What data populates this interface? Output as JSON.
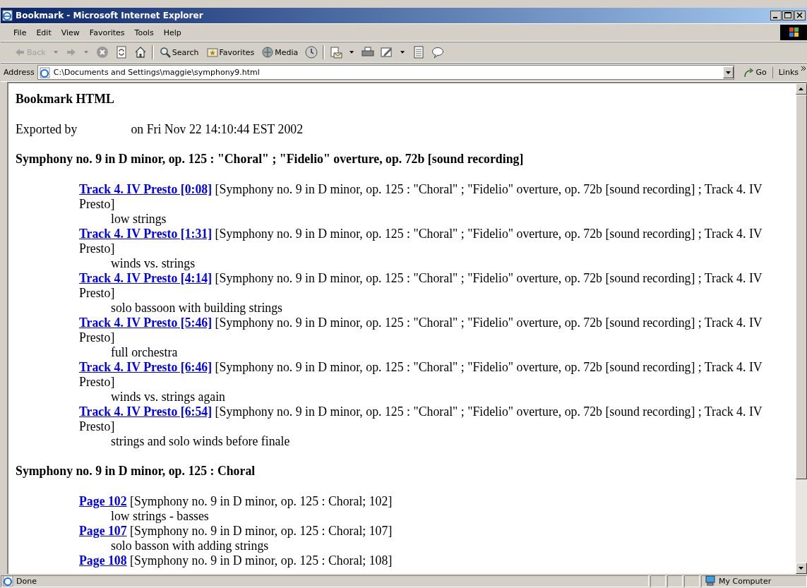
{
  "window": {
    "title": "Bookmark - Microsoft Internet Explorer"
  },
  "menu": [
    "File",
    "Edit",
    "View",
    "Favorites",
    "Tools",
    "Help"
  ],
  "toolbar": {
    "back": {
      "label": "Back",
      "disabled": true
    },
    "search": "Search",
    "favorites": "Favorites",
    "media": "Media"
  },
  "address": {
    "label": "Address",
    "value": "C:\\Documents and Settings\\maggie\\symphony9.html",
    "go": "Go",
    "links": "Links"
  },
  "document": {
    "heading": "Bookmark HTML",
    "exported_by": "Exported by",
    "exported_on": "on Fri Nov 22 14:10:44 EST 2002",
    "sections": [
      {
        "title": "Symphony no. 9 in D minor, op. 125 : \"Choral\" ; \"Fidelio\" overture, op. 72b [sound recording]",
        "entries": [
          {
            "link": "Track 4. IV Presto [0:08]",
            "source": "[Symphony no. 9 in D minor, op. 125 : \"Choral\" ; \"Fidelio\" overture, op. 72b [sound recording] ; Track 4. IV Presto]",
            "note": "low strings"
          },
          {
            "link": "Track 4. IV Presto [1:31]",
            "source": "[Symphony no. 9 in D minor, op. 125 : \"Choral\" ; \"Fidelio\" overture, op. 72b [sound recording] ; Track 4. IV Presto]",
            "note": "winds vs. strings"
          },
          {
            "link": "Track 4. IV Presto [4:14]",
            "source": "[Symphony no. 9 in D minor, op. 125 : \"Choral\" ; \"Fidelio\" overture, op. 72b [sound recording] ; Track 4. IV Presto]",
            "note": "solo bassoon with building strings"
          },
          {
            "link": "Track 4. IV Presto [5:46]",
            "source": "[Symphony no. 9 in D minor, op. 125 : \"Choral\" ; \"Fidelio\" overture, op. 72b [sound recording] ; Track 4. IV Presto]",
            "note": "full orchestra"
          },
          {
            "link": "Track 4. IV Presto [6:46]",
            "source": "[Symphony no. 9 in D minor, op. 125 : \"Choral\" ; \"Fidelio\" overture, op. 72b [sound recording] ; Track 4. IV Presto]",
            "note": "winds vs. strings again"
          },
          {
            "link": "Track 4. IV Presto [6:54]",
            "source": "[Symphony no. 9 in D minor, op. 125 : \"Choral\" ; \"Fidelio\" overture, op. 72b [sound recording] ; Track 4. IV Presto]",
            "note": "strings and solo winds before finale"
          }
        ]
      },
      {
        "title": "Symphony no. 9 in D minor, op. 125 : Choral",
        "entries": [
          {
            "link": "Page 102",
            "source": "[Symphony no. 9 in D minor, op. 125 : Choral; 102]",
            "note": "low strings - basses"
          },
          {
            "link": "Page 107",
            "source": "[Symphony no. 9 in D minor, op. 125 : Choral; 107]",
            "note": "solo basson with adding strings"
          },
          {
            "link": "Page 108",
            "source": "[Symphony no. 9 in D minor, op. 125 : Choral; 108]"
          }
        ]
      }
    ]
  },
  "status_bar": {
    "text": "Done",
    "zone": "My Computer"
  }
}
